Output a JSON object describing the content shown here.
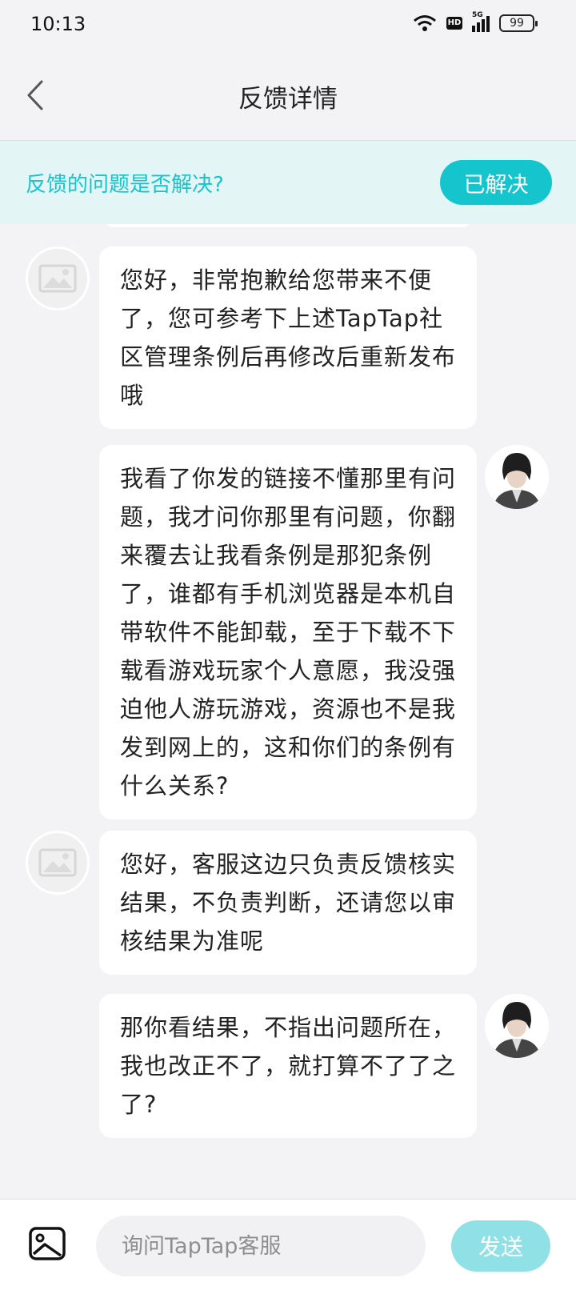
{
  "status_bar": {
    "time": "10:13",
    "hd": "HD",
    "network": "5G",
    "battery": "99"
  },
  "nav": {
    "title": "反馈详情"
  },
  "resolve": {
    "question": "反馈的问题是否解决?",
    "button_label": "已解决"
  },
  "messages": [
    {
      "sender": "staff",
      "text": "您好，非常抱歉给您带来不便了，您可参考下上述TapTap社区管理条例后再修改后重新发布哦"
    },
    {
      "sender": "user",
      "text": "我看了你发的链接不懂那里有问题，我才问你那里有问题，你翻来覆去让我看条例是那犯条例了，谁都有手机浏览器是本机自带软件不能卸载，至于下载不下载看游戏玩家个人意愿，我没强迫他人游玩游戏，资源也不是我发到网上的，这和你们的条例有什么关系?"
    },
    {
      "sender": "staff",
      "text": "您好，客服这边只负责反馈核实结果，不负责判断，还请您以审核结果为准呢"
    },
    {
      "sender": "user",
      "text": "那你看结果，不指出问题所在，我也改正不了，就打算不了了之了?"
    }
  ],
  "input": {
    "placeholder": "询问TapTap客服",
    "send_label": "发送"
  },
  "colors": {
    "accent": "#15c5ce",
    "accent_light": "#8fe1e5",
    "resolve_bg": "#e4f5f6"
  }
}
